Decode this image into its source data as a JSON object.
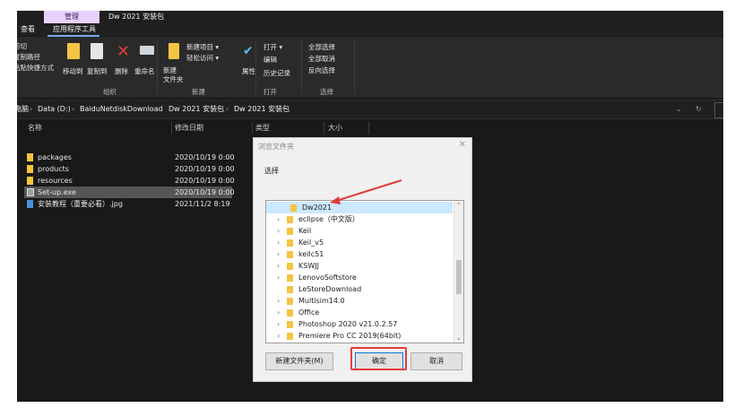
{
  "window": {
    "context_tab": "管理",
    "title": "Dw 2021 安装包",
    "tabs": [
      "查看",
      "应用程序工具"
    ]
  },
  "ribbon": {
    "clipboard_small": [
      "剪切",
      "复制路径",
      "粘贴快捷方式"
    ],
    "organize_items": [
      "移动到",
      "复制到",
      "删除",
      "重命名"
    ],
    "new_folder": "新建\n文件夹",
    "new_item": "新建项目 ▾",
    "easy_access": "轻松访问 ▾",
    "properties": "属性",
    "open": "打开 ▾",
    "edit": "编辑",
    "history": "历史记录",
    "select_all": "全部选择",
    "select_none": "全部取消",
    "invert_select": "反向选择",
    "groups": [
      "组织",
      "新建",
      "打开",
      "选择"
    ]
  },
  "address": {
    "crumbs": [
      "电脑",
      "Data (D:)",
      "BaiduNetdiskDownload",
      "Dw 2021 安装包",
      "Dw 2021 安装包"
    ]
  },
  "file_list": {
    "columns": [
      "名称",
      "修改日期",
      "类型",
      "大小"
    ],
    "rows": [
      {
        "name": "packages",
        "date": "2020/10/19 0:00",
        "kind": "folder"
      },
      {
        "name": "products",
        "date": "2020/10/19 0:00",
        "kind": "folder"
      },
      {
        "name": "resources",
        "date": "2020/10/19 0:00",
        "kind": "folder"
      },
      {
        "name": "Set-up.exe",
        "date": "2020/10/19 0:00",
        "kind": "exe"
      },
      {
        "name": "安装教程（重要必看）.jpg",
        "date": "2021/11/2 8:19",
        "kind": "image"
      }
    ]
  },
  "dialog": {
    "title": "浏览文件夹",
    "label": "选择",
    "tree_items": [
      "Dw2021",
      "eclipse（中文版）",
      "Keil",
      "Keil_v5",
      "keilc51",
      "KSWJJ",
      "LenovoSoftstore",
      "LeStoreDownload",
      "Multisim14.0",
      "Office",
      "Photoshop 2020 v21.0.2.57",
      "Premiere Pro CC 2019(64bit)"
    ],
    "new_folder_button": "新建文件夹(M)",
    "ok_button": "确定",
    "cancel_button": "取消"
  },
  "colors": {
    "highlight_red": "#e23b3b",
    "context_tab": "#e7d2ff",
    "folder": "#f4c542"
  }
}
